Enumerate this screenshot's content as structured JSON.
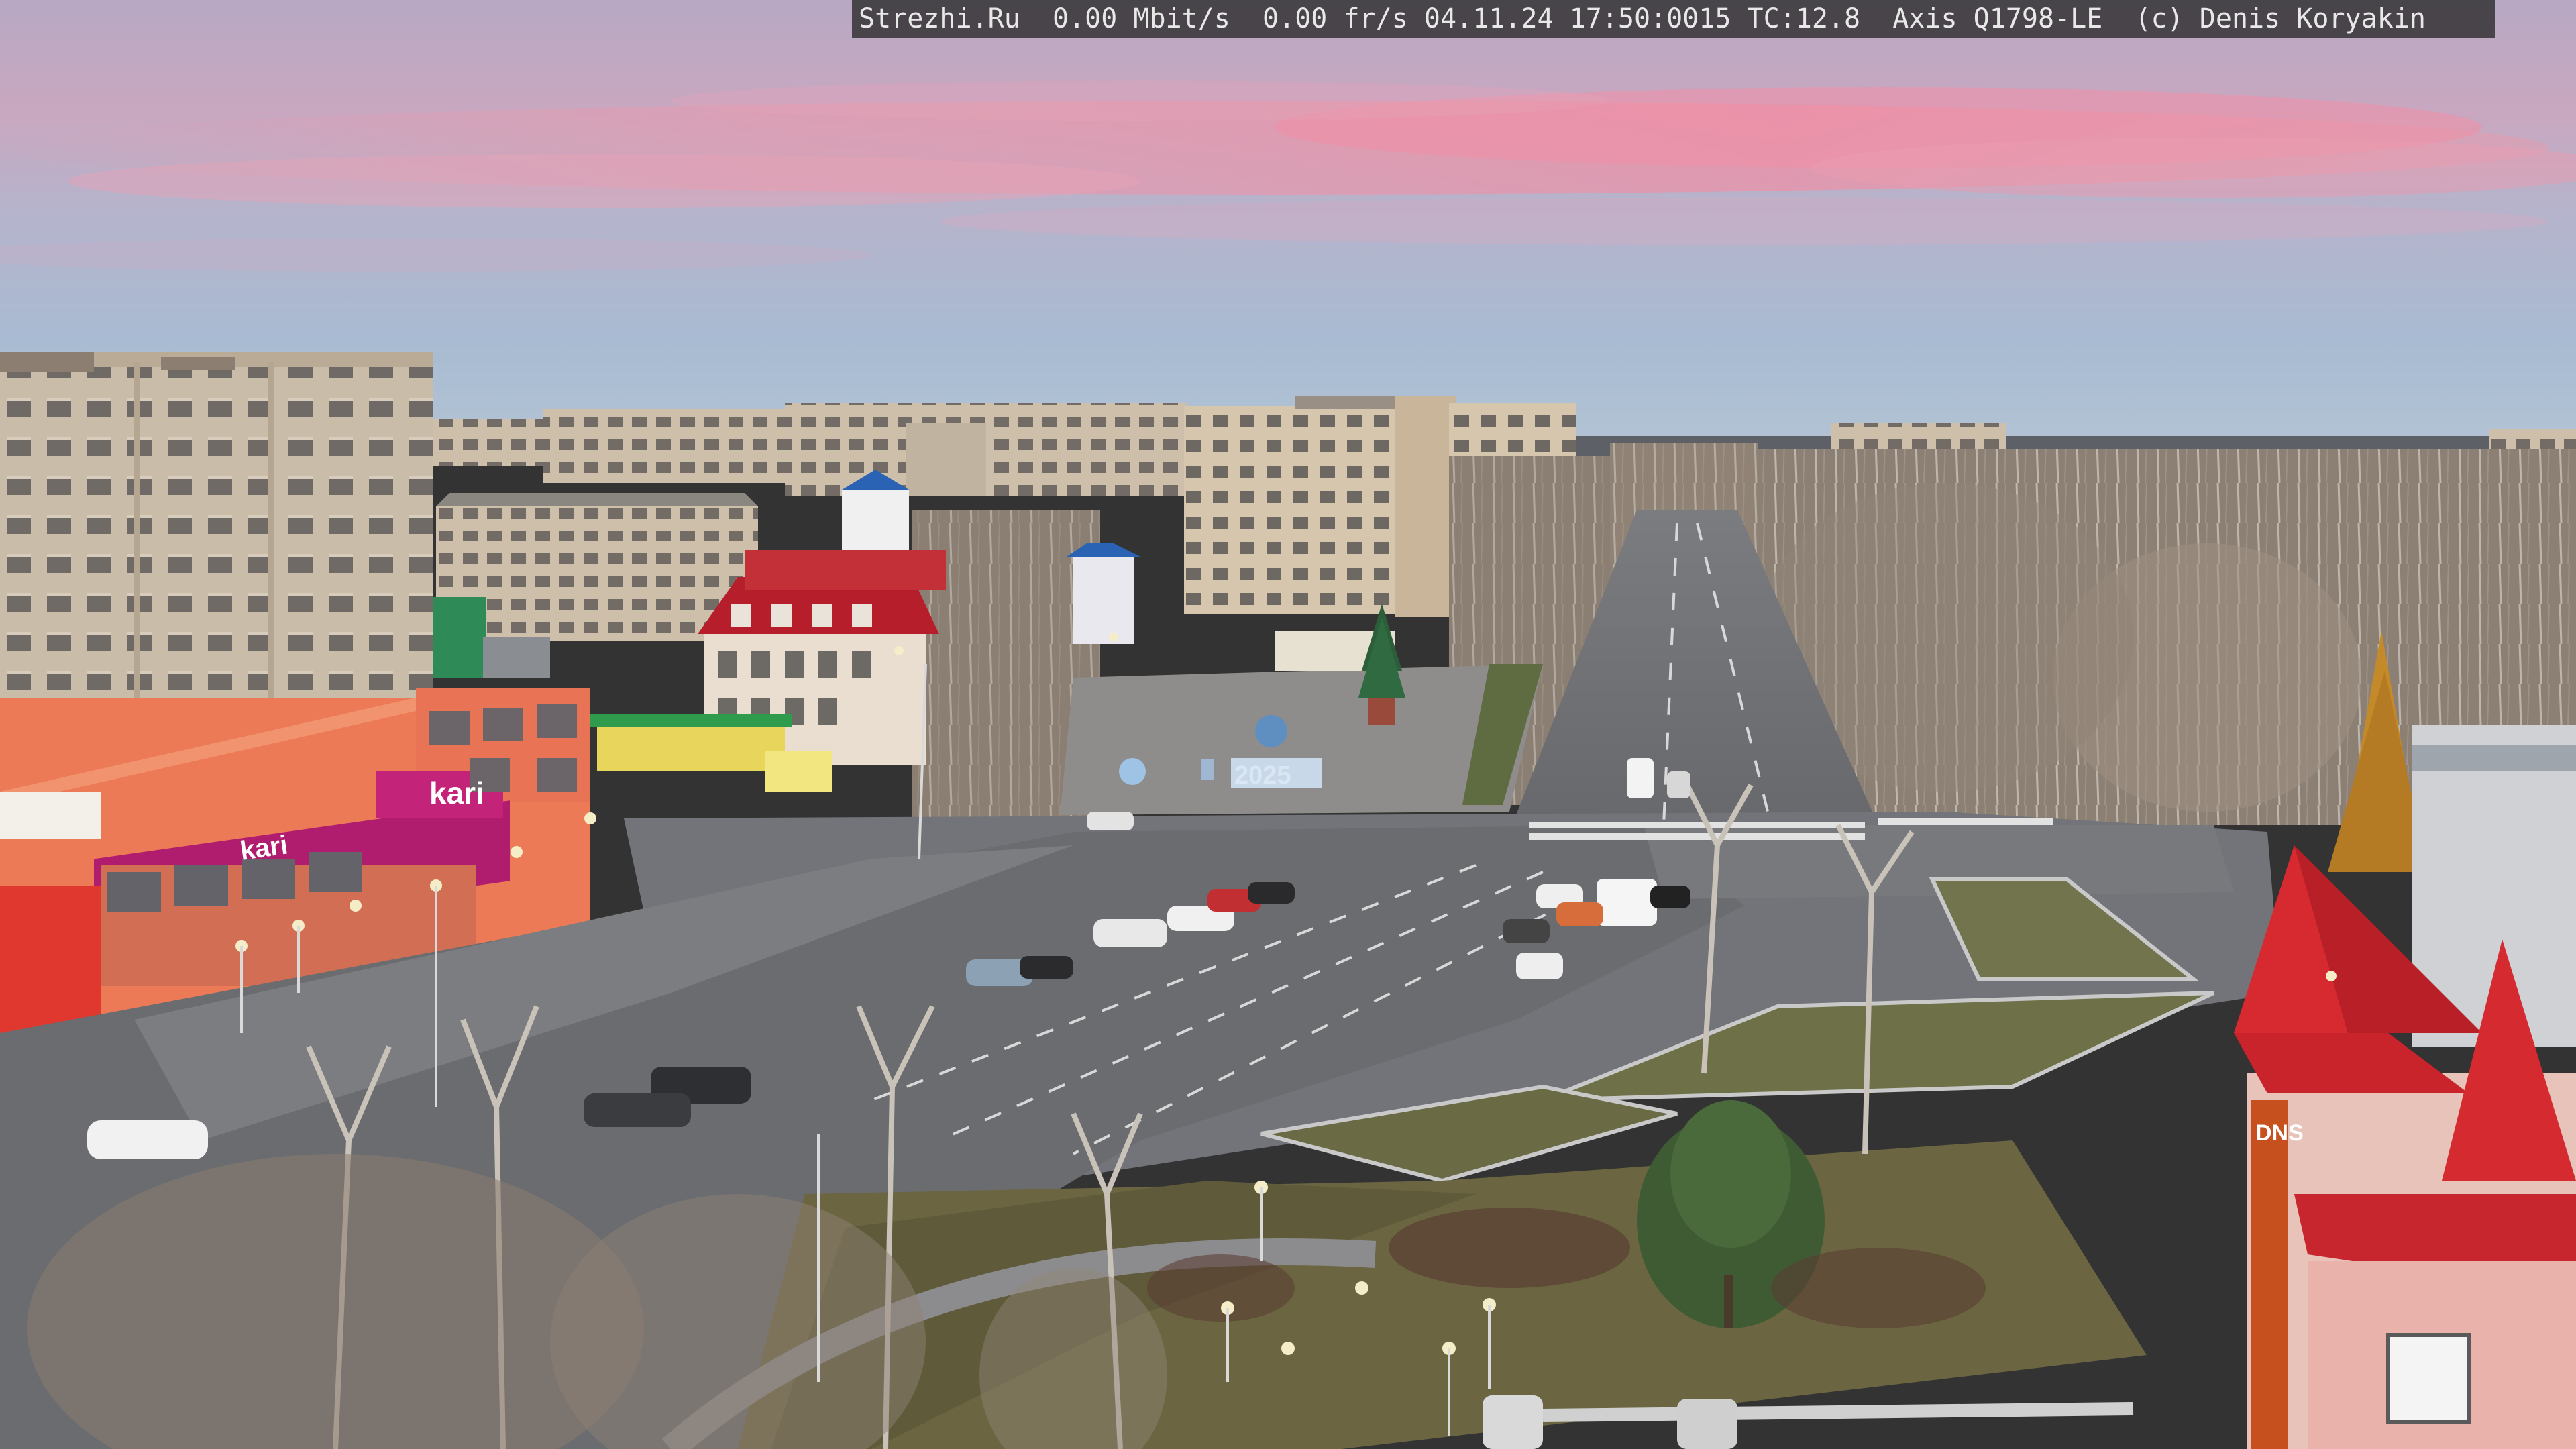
{
  "camera_overlay": {
    "text": "Strezhi.Ru  0.00 Mbit/s  0.00 fr/s 04.11.24 17:50:0015 TC:12.8  Axis Q1798-LE  (c) Denis Koryakin"
  },
  "signage": {
    "store_brand": "kari",
    "store_brand_secondary": "kari",
    "year_sculpture": "2025",
    "shop_sign": "DNS"
  },
  "colors": {
    "sky_top": "#b9a9c2",
    "sky_pink": "#e79aaa",
    "sky_bottom": "#a9bcd3",
    "asphalt": "#6f7175",
    "roof_red": "#c8262e",
    "brand_magenta": "#b01c6e"
  }
}
